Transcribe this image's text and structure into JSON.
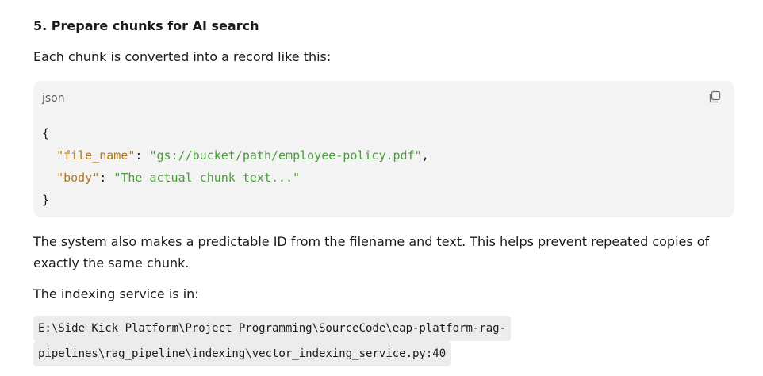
{
  "section": {
    "heading": "5. Prepare chunks for AI search",
    "intro": "Each chunk is converted into a record like this:",
    "code_block": {
      "language": "json",
      "copy_icon": "copy-icon",
      "open_brace": "{",
      "close_brace": "}",
      "field1_key": "\"file_name\"",
      "field1_colon": ": ",
      "field1_value": "\"gs://bucket/path/employee-policy.pdf\"",
      "field1_comma": ",",
      "field2_key": "\"body\"",
      "field2_colon": ": ",
      "field2_value": "\"The actual chunk text...\""
    },
    "explanation": "The system also makes a predictable ID from the filename and text. This helps prevent repeated copies of exactly the same chunk.",
    "location_intro": "The indexing service is in:",
    "path_line1": "E:\\Side Kick Platform\\Project Programming\\SourceCode\\eap-platform-rag-",
    "path_line2": "pipelines\\rag_pipeline\\indexing\\vector_indexing_service.py:40"
  },
  "colors": {
    "key": "#b07a19",
    "string": "#4a9a3a",
    "code_bg": "#f3f3f3"
  }
}
